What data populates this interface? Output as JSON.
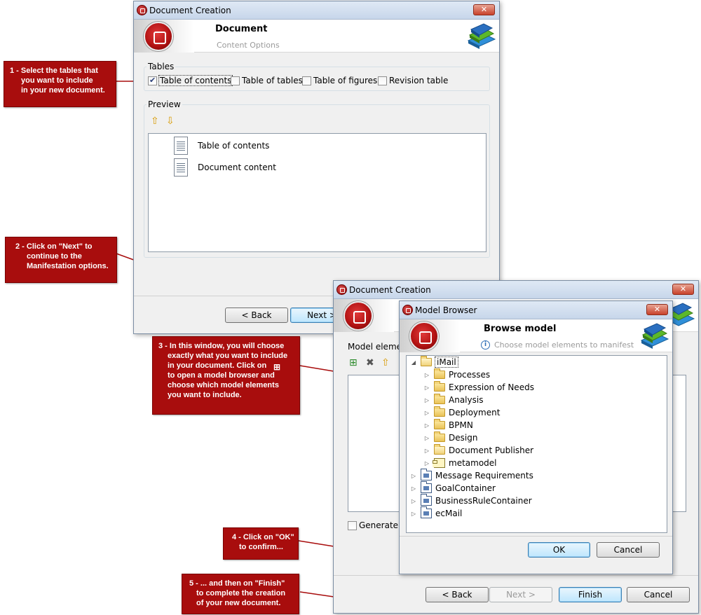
{
  "callouts": {
    "c1": [
      "1 - Select the tables that",
      "you want to include",
      "in your new document."
    ],
    "c2": [
      "2 - Click on \"Next\" to",
      "continue to the",
      "Manifestation options."
    ],
    "c3": [
      "3 - In this window, you will choose",
      "exactly what you want to include",
      "in your document. Click on",
      "to open a model browser and",
      "choose which model elements",
      "you want to include."
    ],
    "c4": [
      "4 - Click on \"OK\"",
      "to confirm..."
    ],
    "c5": [
      "5 - ... and then on \"Finish\"",
      "to complete the creation",
      "of your new document."
    ]
  },
  "win1": {
    "title": "Document Creation",
    "close": "✕",
    "header_title": "Document",
    "header_subtitle": "Content Options",
    "tables_legend": "Tables",
    "checkboxes": [
      {
        "label": "Table of contents",
        "checked": true
      },
      {
        "label": "Table of tables",
        "checked": false
      },
      {
        "label": "Table of figures",
        "checked": false
      },
      {
        "label": "Revision table",
        "checked": false
      }
    ],
    "preview_legend": "Preview",
    "preview_items": [
      "Table of contents",
      "Document content"
    ],
    "back_button": "< Back",
    "next_button": "Next >"
  },
  "win2": {
    "title": "Document Creation",
    "close": "✕",
    "model_elements_label": "Model elemen",
    "generate_label": "Generate d",
    "back_button": "< Back",
    "next_button": "Next >",
    "finish_button": "Finish",
    "cancel_button": "Cancel"
  },
  "win3": {
    "title": "Model Browser",
    "close": "✕",
    "header_title": "Browse model",
    "header_subtitle": "Choose model elements to manifest",
    "tree": [
      {
        "label": "iMail",
        "icon": "folder-open-icon",
        "twisty": "◢",
        "level": 0
      },
      {
        "label": "Processes",
        "icon": "folder-icon",
        "twisty": "▷",
        "level": 1
      },
      {
        "label": "Expression of Needs",
        "icon": "folder-icon",
        "twisty": "▷",
        "level": 1
      },
      {
        "label": "Analysis",
        "icon": "folder-icon",
        "twisty": "▷",
        "level": 1
      },
      {
        "label": "Deployment",
        "icon": "folder-icon",
        "twisty": "▷",
        "level": 1
      },
      {
        "label": "BPMN",
        "icon": "folder-icon",
        "twisty": "▷",
        "level": 1
      },
      {
        "label": "Design",
        "icon": "folder-icon",
        "twisty": "▷",
        "level": 1
      },
      {
        "label": "Document Publisher",
        "icon": "folder-open-icon",
        "twisty": "▷",
        "level": 1
      },
      {
        "label": "metamodel",
        "icon": "component-icon",
        "twisty": "▷",
        "level": 1
      },
      {
        "label": "Message Requirements",
        "icon": "package-icon",
        "twisty": "▷",
        "level": 0
      },
      {
        "label": "GoalContainer",
        "icon": "package-icon",
        "twisty": "▷",
        "level": 0
      },
      {
        "label": "BusinessRuleContainer",
        "icon": "package-icon",
        "twisty": "▷",
        "level": 0
      },
      {
        "label": "ecMail",
        "icon": "package-icon",
        "twisty": "▷",
        "level": 0
      }
    ],
    "ok_button": "OK",
    "cancel_button": "Cancel"
  },
  "colors": {
    "callout": "#a80d0d",
    "window_bg": "#f0f0f0",
    "titlebar": "#c7d6ea"
  }
}
